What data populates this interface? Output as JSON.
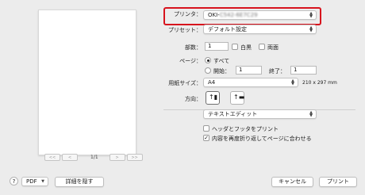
{
  "preview": {
    "page_counter": "1/1",
    "nav": {
      "first": "<<",
      "prev": "<",
      "next": ">",
      "last": ">>"
    }
  },
  "printer": {
    "label": "プリンタ：",
    "value_prefix": "OKI-",
    "value_masked": "C542-6E7C29"
  },
  "presets": {
    "label": "プリセット：",
    "value": "デフォルト設定"
  },
  "copies": {
    "label": "部数：",
    "value": "1",
    "bw_label": "白黒",
    "duplex_label": "両面"
  },
  "pages": {
    "label": "ページ：",
    "all_label": "すべて",
    "from_label": "開始：",
    "from_value": "1",
    "to_label": "終了：",
    "to_value": "1"
  },
  "paper_size": {
    "label": "用紙サイズ：",
    "value": "A4",
    "dimensions": "210 x 297 mm"
  },
  "orientation": {
    "label": "方向："
  },
  "app_section": {
    "value": "テキストエディット"
  },
  "options": {
    "header_footer": "ヘッダとフッタをプリント",
    "rewrap": "内容を再度折り返してページに合わせる"
  },
  "footer": {
    "help": "?",
    "pdf": "PDF",
    "hide_details": "詳細を隠す",
    "cancel": "キャンセル",
    "print": "プリント"
  }
}
